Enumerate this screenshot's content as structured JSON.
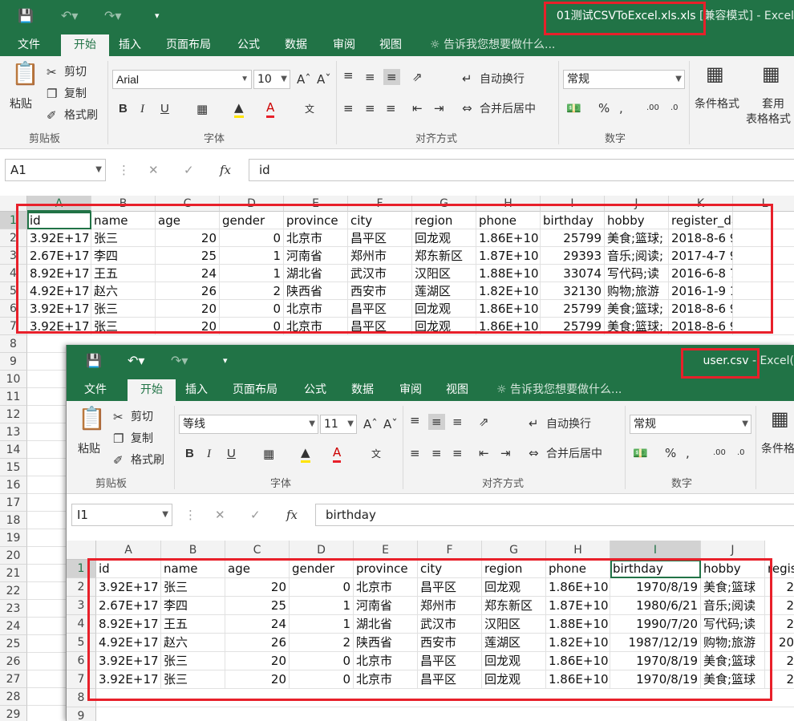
{
  "window1": {
    "title_file": "01测试CSVToExcel.xls.xls",
    "title_rest": "  [兼容模式] - Excel",
    "tabs": [
      "文件",
      "开始",
      "插入",
      "页面布局",
      "公式",
      "数据",
      "审阅",
      "视图"
    ],
    "tell_me": "告诉我您想要做什么...",
    "ribbon": {
      "paste": "粘贴",
      "cut": "剪切",
      "copy": "复制",
      "format_painter": "格式刷",
      "clipboard_group": "剪贴板",
      "font_name": "Arial",
      "font_size": "10",
      "font_group": "字体",
      "bold": "B",
      "italic": "I",
      "underline": "U",
      "wrap_text": "自动换行",
      "merge_center": "合并后居中",
      "align_group": "对齐方式",
      "number_format": "常规",
      "number_group": "数字",
      "cond_format": "条件格式",
      "table_format_1": "套用",
      "table_format_2": "表格格式"
    },
    "name_box": "A1",
    "formula_value": "id",
    "columns": [
      "A",
      "B",
      "C",
      "D",
      "E",
      "F",
      "G",
      "H",
      "I",
      "J",
      "K",
      "L"
    ],
    "row_numbers": [
      "1",
      "2",
      "3",
      "4",
      "5",
      "6",
      "7",
      "8",
      "9",
      "10",
      "11",
      "12",
      "13",
      "14",
      "15",
      "16",
      "17",
      "18",
      "19",
      "20",
      "21",
      "22",
      "23",
      "24",
      "25",
      "26",
      "27",
      "28",
      "29"
    ],
    "header_row": [
      "id",
      "name",
      "age",
      "gender",
      "province",
      "city",
      "region",
      "phone",
      "birthday",
      "hobby",
      "register_date"
    ],
    "rows": [
      [
        "3.92E+17",
        "张三",
        "20",
        "0",
        "北京市",
        "昌平区",
        "回龙观",
        "1.86E+10",
        "25799",
        "美食;篮球;",
        "2018-8-6 9:44"
      ],
      [
        "2.67E+17",
        "李四",
        "25",
        "1",
        "河南省",
        "郑州市",
        "郑东新区",
        "1.87E+10",
        "29393",
        "音乐;阅读;",
        "2017-4-7 9:14"
      ],
      [
        "8.92E+17",
        "王五",
        "24",
        "1",
        "湖北省",
        "武汉市",
        "汉阳区",
        "1.88E+10",
        "33074",
        "写代码;读",
        "2016-6-8 7:34"
      ],
      [
        "4.92E+17",
        "赵六",
        "26",
        "2",
        "陕西省",
        "西安市",
        "莲湖区",
        "1.82E+10",
        "32130",
        "购物;旅游",
        "2016-1-9 19:15"
      ],
      [
        "3.92E+17",
        "张三",
        "20",
        "0",
        "北京市",
        "昌平区",
        "回龙观",
        "1.86E+10",
        "25799",
        "美食;篮球;",
        "2018-8-6 9:44"
      ],
      [
        "3.92E+17",
        "张三",
        "20",
        "0",
        "北京市",
        "昌平区",
        "回龙观",
        "1.86E+10",
        "25799",
        "美食;篮球;",
        "2018-8-6 9:44"
      ]
    ]
  },
  "window2": {
    "title_file": "user.csv",
    "title_rest": " - Excel(",
    "tabs": [
      "文件",
      "开始",
      "插入",
      "页面布局",
      "公式",
      "数据",
      "审阅",
      "视图"
    ],
    "tell_me": "告诉我您想要做什么...",
    "ribbon": {
      "paste": "粘贴",
      "cut": "剪切",
      "copy": "复制",
      "format_painter": "格式刷",
      "clipboard_group": "剪贴板",
      "font_name": "等线",
      "font_size": "11",
      "font_group": "字体",
      "bold": "B",
      "italic": "I",
      "underline": "U",
      "wrap_text": "自动换行",
      "merge_center": "合并后居中",
      "align_group": "对齐方式",
      "number_format": "常规",
      "number_group": "数字",
      "cond_format": "条件格"
    },
    "name_box": "I1",
    "formula_value": "birthday",
    "columns": [
      "A",
      "B",
      "C",
      "D",
      "E",
      "F",
      "G",
      "H",
      "I",
      "J"
    ],
    "row_numbers": [
      "1",
      "2",
      "3",
      "4",
      "5",
      "6",
      "7",
      "8",
      "9"
    ],
    "header_row": [
      "id",
      "name",
      "age",
      "gender",
      "province",
      "city",
      "region",
      "phone",
      "birthday",
      "hobby",
      "regis"
    ],
    "rows": [
      [
        "3.92E+17",
        "张三",
        "20",
        "0",
        "北京市",
        "昌平区",
        "回龙观",
        "1.86E+10",
        "1970/8/19",
        "美食;篮球",
        "2"
      ],
      [
        "2.67E+17",
        "李四",
        "25",
        "1",
        "河南省",
        "郑州市",
        "郑东新区",
        "1.87E+10",
        "1980/6/21",
        "音乐;阅读",
        "2"
      ],
      [
        "8.92E+17",
        "王五",
        "24",
        "1",
        "湖北省",
        "武汉市",
        "汉阳区",
        "1.88E+10",
        "1990/7/20",
        "写代码;读",
        "2"
      ],
      [
        "4.92E+17",
        "赵六",
        "26",
        "2",
        "陕西省",
        "西安市",
        "莲湖区",
        "1.82E+10",
        "1987/12/19",
        "购物;旅游",
        "20"
      ],
      [
        "3.92E+17",
        "张三",
        "20",
        "0",
        "北京市",
        "昌平区",
        "回龙观",
        "1.86E+10",
        "1970/8/19",
        "美食;篮球",
        "2"
      ],
      [
        "3.92E+17",
        "张三",
        "20",
        "0",
        "北京市",
        "昌平区",
        "回龙观",
        "1.86E+10",
        "1970/8/19",
        "美食;篮球",
        "2"
      ]
    ]
  },
  "colors": {
    "excel_green": "#217346",
    "highlight_red": "#e8202a",
    "ribbon_bg": "#f3f3f3"
  }
}
